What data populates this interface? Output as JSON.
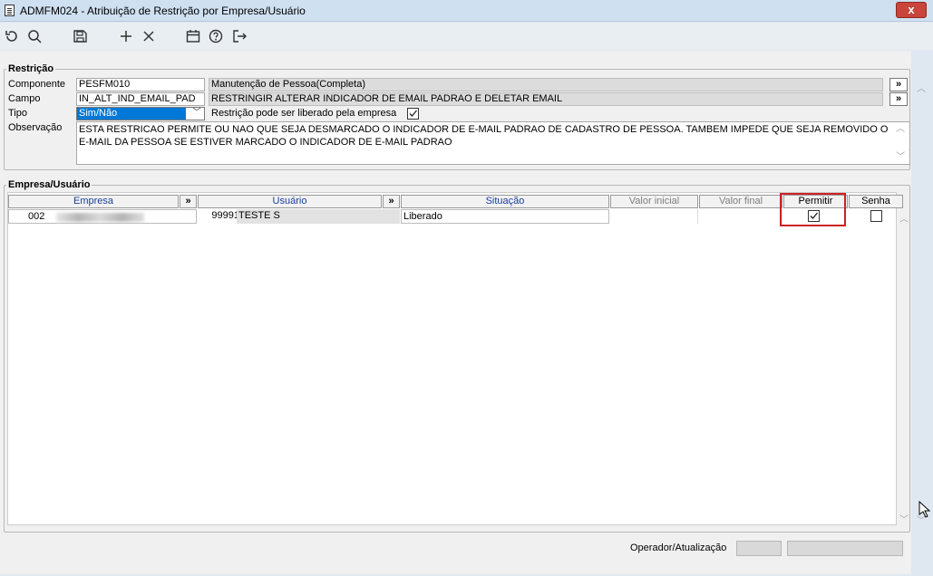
{
  "window": {
    "title": "ADMFM024 - Atribuição de Restrição por Empresa/Usuário",
    "close_label": "x"
  },
  "restricao": {
    "legend": "Restrição",
    "componente_label": "Componente",
    "componente_value": "PESFM010",
    "componente_desc": "Manutenção de Pessoa(Completa)",
    "campo_label": "Campo",
    "campo_value": "IN_ALT_IND_EMAIL_PAD",
    "campo_desc": "RESTRINGIR ALTERAR INDICADOR DE EMAIL PADRAO E DELETAR EMAIL",
    "tipo_label": "Tipo",
    "tipo_value": "Sim/Não",
    "liberado_label": "Restrição pode ser liberado pela empresa",
    "liberado_checked": true,
    "observacao_label": "Observação",
    "observacao_value": "ESTA RESTRICAO PERMITE OU NAO QUE SEJA DESMARCADO O INDICADOR DE E-MAIL PADRAO DE CADASTRO DE PESSOA. TAMBEM IMPEDE QUE SEJA REMOVIDO O E-MAIL DA PESSOA SE ESTIVER MARCADO O INDICADOR DE E-MAIL PADRAO",
    "more_label": "»"
  },
  "empresa_usuario": {
    "legend": "Empresa/Usuário",
    "columns": {
      "empresa": "Empresa",
      "usuario": "Usuário",
      "situacao": "Situação",
      "valor_inicial": "Valor inicial",
      "valor_final": "Valor final",
      "permitir": "Permitir",
      "senha": "Senha",
      "more": "»"
    },
    "rows": [
      {
        "empresa_code": "002",
        "usuario_code": "99991",
        "usuario_name": "TESTE S",
        "situacao": "Liberado",
        "permitir": true,
        "senha": false
      }
    ]
  },
  "footer": {
    "operador_label": "Operador/Atualização"
  },
  "colors": {
    "header_text": "#1a3e9a",
    "selection": "#0078d7",
    "highlight": "#c22222"
  }
}
